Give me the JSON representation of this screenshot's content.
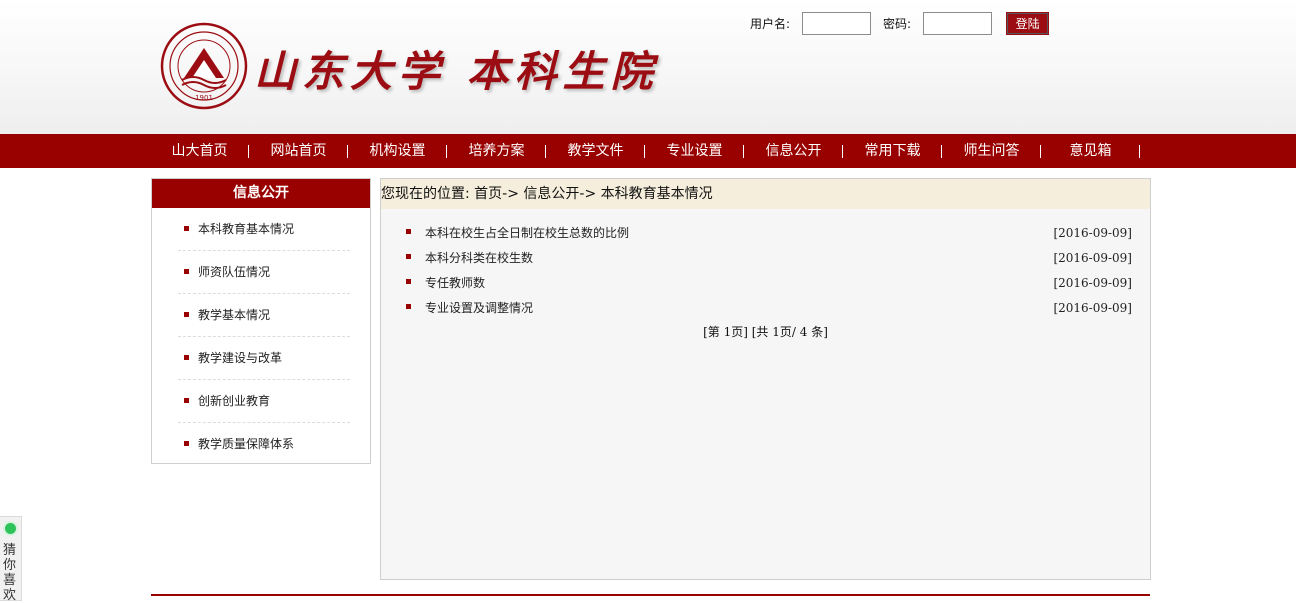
{
  "brand": {
    "name": "山东大学 本科生院",
    "seal_top_text": "山东大学",
    "seal_ring_text": "SHANDONG UNIVERSITY",
    "seal_year": "1901",
    "brand_color": "#990000"
  },
  "login": {
    "username_label": "用户名:",
    "username_value": "",
    "password_label": "密码:",
    "password_value": "",
    "submit_label": "登陆"
  },
  "nav": {
    "items": [
      {
        "label": "山大首页"
      },
      {
        "label": "网站首页"
      },
      {
        "label": "机构设置"
      },
      {
        "label": "培养方案"
      },
      {
        "label": "教学文件"
      },
      {
        "label": "专业设置"
      },
      {
        "label": "信息公开"
      },
      {
        "label": "常用下载"
      },
      {
        "label": "师生问答"
      },
      {
        "label": "意见箱"
      }
    ]
  },
  "sidebar": {
    "title": "信息公开",
    "items": [
      {
        "label": "本科教育基本情况"
      },
      {
        "label": "师资队伍情况"
      },
      {
        "label": "教学基本情况"
      },
      {
        "label": "教学建设与改革"
      },
      {
        "label": "创新创业教育"
      },
      {
        "label": "教学质量保障体系"
      }
    ]
  },
  "breadcrumb": {
    "text": "您现在的位置: 首页-> 信息公开-> 本科教育基本情况"
  },
  "articles": [
    {
      "title": "本科在校生占全日制在校生总数的比例",
      "date": "[2016-09-09]"
    },
    {
      "title": "本科分科类在校生数",
      "date": "[2016-09-09]"
    },
    {
      "title": "专任教师数",
      "date": "[2016-09-09]"
    },
    {
      "title": "专业设置及调整情况",
      "date": "[2016-09-09]"
    }
  ],
  "pager": {
    "text": "[第 1页] [共 1页/ 4 条]"
  },
  "side_widget": {
    "label": "猜你喜欢"
  }
}
